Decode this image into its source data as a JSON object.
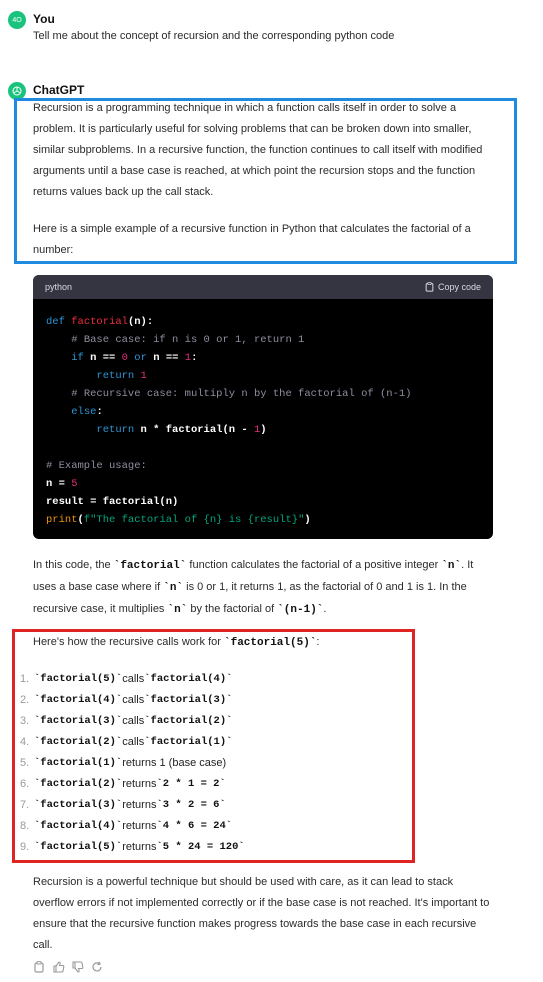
{
  "user": {
    "avatar_text": "4O",
    "name": "You",
    "message": "Tell me about the concept of recursion and the corresponding python code"
  },
  "assistant": {
    "name": "ChatGPT",
    "intro": "Recursion is a programming technique in which a function calls itself in order to solve a problem. It is particularly useful for solving problems that can be broken down into smaller, similar subproblems. In a recursive function, the function continues to call itself with modified arguments until a base case is reached, at which point the recursion stops and the function returns values back up the call stack.",
    "example_intro": "Here is a simple example of a recursive function in Python that calculates the factorial of a number:",
    "code_block": {
      "language": "python",
      "copy_label": "Copy code",
      "lines": [
        "def factorial(n):",
        "    # Base case: if n is 0 or 1, return 1",
        "    if n == 0 or n == 1:",
        "        return 1",
        "    # Recursive case: multiply n by the factorial of (n-1)",
        "    else:",
        "        return n * factorial(n - 1)",
        "",
        "# Example usage:",
        "n = 5",
        "result = factorial(n)",
        "print(f\"The factorial of {n} is {result}\")"
      ]
    },
    "explanation": {
      "p1_a": "In this code, the ",
      "p1_code1": "`factorial`",
      "p1_b": " function calculates the factorial of a positive integer ",
      "p1_code2": "`n`",
      "p1_c": ". It uses a base case where if ",
      "p1_code3": "`n`",
      "p1_d": " is 0 or 1, it returns 1, as the factorial of 0 and 1 is 1. In the recursive case, it multiplies ",
      "p1_code4": "`n`",
      "p1_e": " by the factorial of ",
      "p1_code5": "`(n-1)`",
      "p1_f": "."
    },
    "calls_intro_a": "Here's how the recursive calls work for ",
    "calls_intro_code": "`factorial(5)`",
    "calls_intro_b": ":",
    "calls": [
      {
        "n": "1.",
        "code1": "`factorial(5)`",
        "verb": " calls ",
        "code2": "`factorial(4)`",
        "tail": ""
      },
      {
        "n": "2.",
        "code1": "`factorial(4)`",
        "verb": " calls ",
        "code2": "`factorial(3)`",
        "tail": ""
      },
      {
        "n": "3.",
        "code1": "`factorial(3)`",
        "verb": " calls ",
        "code2": "`factorial(2)`",
        "tail": ""
      },
      {
        "n": "4.",
        "code1": "`factorial(2)`",
        "verb": " calls ",
        "code2": "`factorial(1)`",
        "tail": ""
      },
      {
        "n": "5.",
        "code1": "`factorial(1)`",
        "verb": " returns 1 (base case)",
        "code2": "",
        "tail": ""
      },
      {
        "n": "6.",
        "code1": "`factorial(2)`",
        "verb": " returns ",
        "code2": "`2 * 1 = 2`",
        "tail": ""
      },
      {
        "n": "7.",
        "code1": "`factorial(3)`",
        "verb": " returns ",
        "code2": "`3 * 2 = 6`",
        "tail": ""
      },
      {
        "n": "8.",
        "code1": "`factorial(4)`",
        "verb": " returns ",
        "code2": "`4 * 6 = 24`",
        "tail": ""
      },
      {
        "n": "9.",
        "code1": "`factorial(5)`",
        "verb": " returns ",
        "code2": "`5 * 24 = 120`",
        "tail": ""
      }
    ],
    "conclusion": "Recursion is a powerful technique but should be used with care, as it can lead to stack overflow errors if not implemented correctly or if the base case is not reached. It's important to ensure that the recursive function makes progress towards the base case in each recursive call."
  },
  "actions": [
    "copy-icon",
    "thumbs-up-icon",
    "thumbs-down-icon",
    "regenerate-icon"
  ],
  "colors": {
    "accent_green": "#19c37d",
    "highlight_blue": "#1e8be0",
    "highlight_red": "#e02424",
    "code_bg": "#000000"
  }
}
